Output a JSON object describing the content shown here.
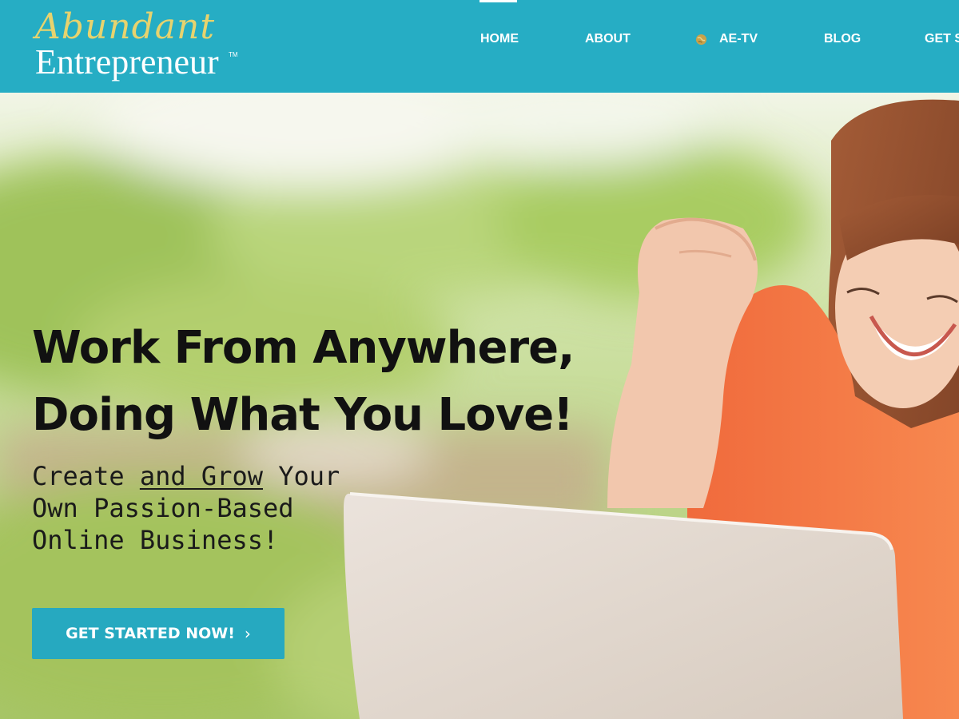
{
  "brand": {
    "script_text": "Abundant",
    "main_text": "Entrepreneur",
    "tm": "TM"
  },
  "nav": {
    "items": [
      {
        "label": "HOME",
        "active": true
      },
      {
        "label": "ABOUT"
      },
      {
        "label": "AE-TV",
        "icon": "globe-icon"
      },
      {
        "label": "BLOG"
      },
      {
        "label": "GET ST"
      }
    ]
  },
  "hero": {
    "headline_line1": "Work From Anywhere,",
    "headline_line2": "Doing What You Love!",
    "sub_part1": "Create ",
    "sub_underlined": "and Grow",
    "sub_part2": " Your",
    "sub_line2": "Own Passion-Based",
    "sub_line3": "Online Business!",
    "cta_label": "GET STARTED NOW!",
    "cta_icon": "chevron-right-icon"
  },
  "colors": {
    "header_bg": "#26adc4",
    "logo_script": "#e7d36e",
    "cta_bg": "#26a9c0",
    "shirt": "#f26a3d"
  }
}
